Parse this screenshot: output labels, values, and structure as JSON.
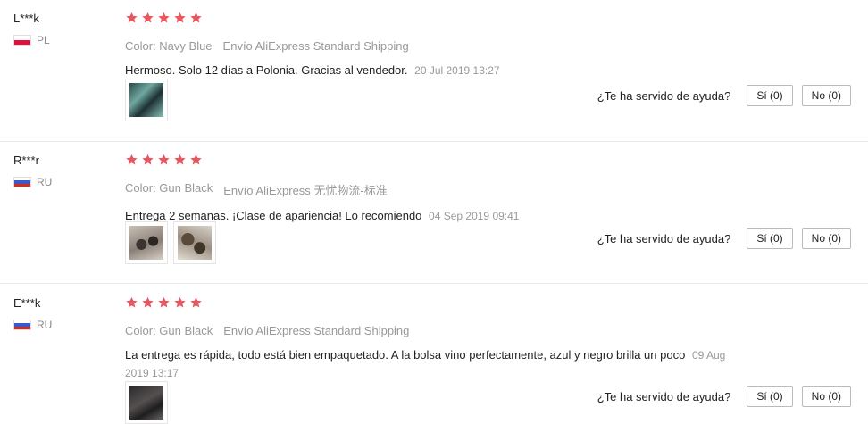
{
  "colors": {
    "star": "#e8565f",
    "divider": "#e8e8e8",
    "muted": "#999999"
  },
  "helpful_label": "¿Te ha servido de ayuda?",
  "reviews": [
    {
      "user": "L***k",
      "country": "PL",
      "rating": 5,
      "color": "Color: Navy Blue",
      "shipping": "Envío AliExpress Standard Shipping",
      "text": "Hermoso. Solo 12 días a Polonia. Gracias al vendedor.",
      "date": "20 Jul 2019 13:27",
      "yes": "Sí (0)",
      "no": "No (0)"
    },
    {
      "user": "R***r",
      "country": "RU",
      "rating": 5,
      "color": "Color: Gun Black",
      "shipping": "Envío AliExpress 无忧物流-标准",
      "text": "Entrega 2 semanas. ¡Clase de apariencia! Lo recomiendo",
      "date": "04 Sep 2019 09:41",
      "yes": "Sí (0)",
      "no": "No (0)"
    },
    {
      "user": "E***k",
      "country": "RU",
      "rating": 5,
      "color": "Color: Gun Black",
      "shipping": "Envío AliExpress Standard Shipping",
      "text": "La entrega es rápida, todo está bien empaquetado. A la bolsa vino perfectamente, azul y negro brilla un poco",
      "date": "09 Aug 2019 13:17",
      "yes": "Sí (0)",
      "no": "No (0)"
    }
  ]
}
